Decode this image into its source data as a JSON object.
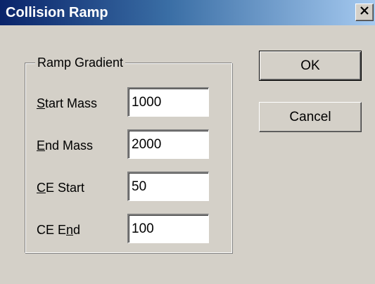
{
  "window": {
    "title": "Collision Ramp",
    "close_icon": "close-icon"
  },
  "group": {
    "legend": "Ramp Gradient"
  },
  "fields": [
    {
      "label_pre": "",
      "label_mnemonic": "S",
      "label_post": "tart Mass",
      "value": "1000"
    },
    {
      "label_pre": "",
      "label_mnemonic": "E",
      "label_post": "nd Mass",
      "value": "2000"
    },
    {
      "label_pre": "",
      "label_mnemonic": "C",
      "label_post": "E Start",
      "value": "50"
    },
    {
      "label_pre": "CE E",
      "label_mnemonic": "n",
      "label_post": "d",
      "value": "100"
    }
  ],
  "buttons": {
    "ok_label": "OK",
    "cancel_label": "Cancel"
  }
}
